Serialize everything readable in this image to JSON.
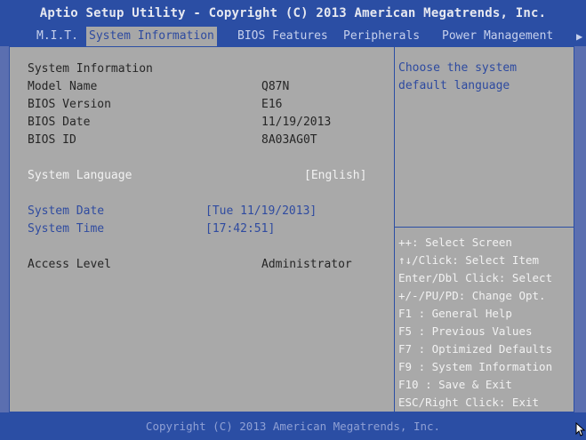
{
  "title": "Aptio Setup Utility - Copyright (C) 2013 American Megatrends, Inc.",
  "tabs": [
    {
      "label": "M.I.T."
    },
    {
      "label": "System Information"
    },
    {
      "label": "BIOS Features"
    },
    {
      "label": "Peripherals"
    },
    {
      "label": "Power Management"
    }
  ],
  "active_tab": "System Information",
  "icons": {
    "more_tabs": "right-arrow-icon",
    "cursor": "mouse-pointer-icon"
  },
  "main": {
    "section_heading": "System Information",
    "info": [
      {
        "label": "Model Name",
        "value": "Q87N"
      },
      {
        "label": "BIOS Version",
        "value": "E16"
      },
      {
        "label": "BIOS Date",
        "value": "11/19/2013"
      },
      {
        "label": "BIOS ID",
        "value": "8A03AG0T"
      }
    ],
    "language": {
      "label": "System Language",
      "value": "[English]"
    },
    "date": {
      "label": "System Date",
      "value": "[Tue 11/19/2013]"
    },
    "time": {
      "label": "System Time",
      "value": "[17:42:51]"
    },
    "access": {
      "label": "Access Level",
      "value": "Administrator"
    }
  },
  "help": {
    "lines": [
      "Choose the system",
      "default language"
    ]
  },
  "keys": [
    "++: Select Screen",
    "↑↓/Click: Select Item",
    "Enter/Dbl Click: Select",
    "+/-/PU/PD: Change Opt.",
    "F1  : General Help",
    "F5  : Previous Values",
    "F7  : Optimized Defaults",
    "F9  : System Information",
    "F10 : Save & Exit",
    "ESC/Right Click: Exit"
  ],
  "footer": "Copyright (C) 2013 American Megatrends, Inc.",
  "colors": {
    "header_bg": "#2b4ea4",
    "panel_bg": "#a9a9a9",
    "active_tab_bg": "#a7a7a7",
    "accent_text": "#2d4aa0"
  }
}
